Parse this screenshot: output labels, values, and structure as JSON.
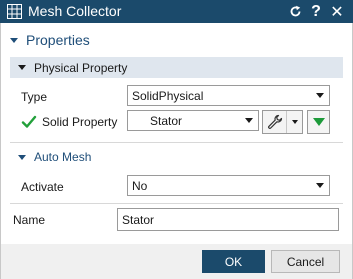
{
  "window": {
    "title": "Mesh Collector",
    "reset_icon": "reset-icon",
    "help_label": "?",
    "close_label": "✕"
  },
  "properties": {
    "label": "Properties",
    "physical_property": {
      "label": "Physical Property",
      "type_label": "Type",
      "type_value": "SolidPhysical",
      "solid_property_label": "Solid Property",
      "solid_property_value": "Stator"
    },
    "auto_mesh": {
      "label": "Auto Mesh",
      "activate_label": "Activate",
      "activate_value": "No"
    },
    "name_label": "Name",
    "name_value": "Stator"
  },
  "footer": {
    "ok_label": "OK",
    "cancel_label": "Cancel"
  },
  "colors": {
    "titlebar": "#1b4a6b",
    "ok_button": "#1b4a6b",
    "check": "#22a03a",
    "green_arrow": "#1d9a3a"
  }
}
